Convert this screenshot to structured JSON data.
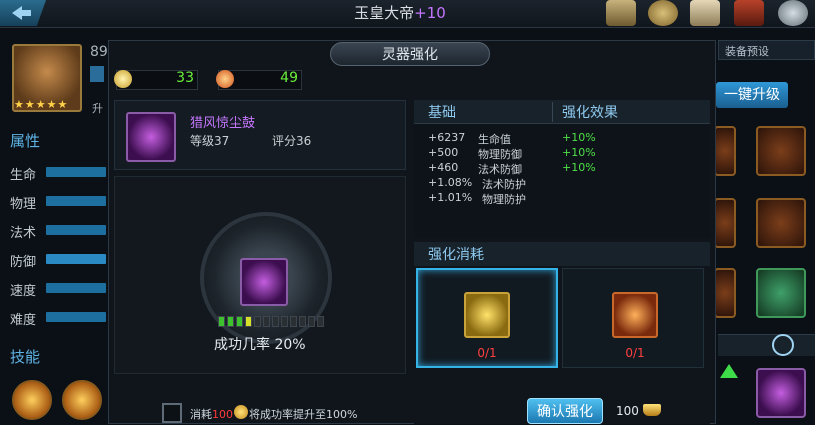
{
  "header": {
    "title": "玉皇大帝",
    "title_bonus": "+10"
  },
  "hero": {
    "level": "89",
    "stars": "★★★★★"
  },
  "side": {
    "attributes_title": "属性",
    "attributes": [
      {
        "label": "生命"
      },
      {
        "label": "物理"
      },
      {
        "label": "法术"
      },
      {
        "label": "防御"
      },
      {
        "label": "速度"
      },
      {
        "label": "难度"
      }
    ],
    "skills_title": "技能",
    "partial_label": "升"
  },
  "right_bg": {
    "preset_tab": "装备预设",
    "upgrade_button": "一键升级"
  },
  "panel": {
    "title": "灵器强化",
    "resources": [
      {
        "icon": "spirit-crystal-icon",
        "value": "33"
      },
      {
        "icon": "fire-stone-icon",
        "value": "49"
      }
    ],
    "item": {
      "name": "猎风惊尘鼓",
      "level": "等级37",
      "score": "评分36"
    },
    "success_rate": "成功几率 20%",
    "progress_pips_filled": 4,
    "progress_pips_total": 12,
    "consume": {
      "prefix": "消耗",
      "amount": "100",
      "suffix": "将成功率提升至100%"
    }
  },
  "info": {
    "base_header": "基础",
    "bonus_header": "强化效果",
    "stats": [
      {
        "base": "+6237",
        "name": "生命值",
        "bonus": "+10%"
      },
      {
        "base": "+500",
        "name": "物理防御",
        "bonus": "+10%"
      },
      {
        "base": "+460",
        "name": "法术防御",
        "bonus": "+10%"
      },
      {
        "base": "+1.08%",
        "name": "法术防护",
        "bonus": ""
      },
      {
        "base": "+1.01%",
        "name": "物理防护",
        "bonus": ""
      }
    ]
  },
  "cost": {
    "title": "强化消耗",
    "items": [
      {
        "icon": "gold-stone-icon",
        "count": "0/1"
      },
      {
        "icon": "fire-crystal-icon",
        "count": "0/1"
      }
    ]
  },
  "confirm": {
    "button": "确认强化",
    "gold_cost": "100"
  },
  "colors": {
    "accent_blue": "#35b2e6",
    "bonus_green": "#4fe048",
    "purple_item": "#c677ff",
    "insufficient_red": "#ff4040"
  }
}
